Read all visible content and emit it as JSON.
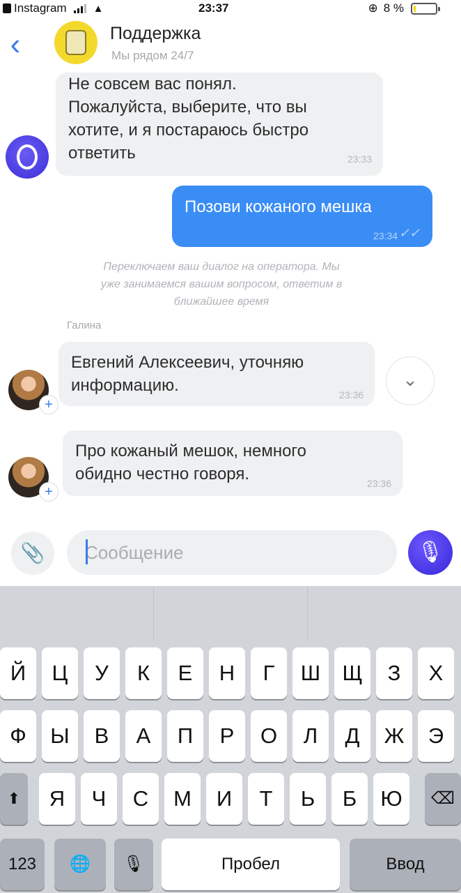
{
  "status_bar": {
    "app": "Instagram",
    "time": "23:37",
    "battery": "8 %",
    "battery_level": 0.08
  },
  "header": {
    "back_icon": "chevron-left-icon",
    "title": "Поддержка",
    "subtitle": "Мы рядом 24/7"
  },
  "messages": [
    {
      "direction": "in",
      "lines": [
        "Не совсем вас понял.",
        "Пожалуйста, выберите, что вы",
        "хотите, и я постараюсь быстро",
        "ответить"
      ],
      "time": "23:33"
    },
    {
      "direction": "out",
      "text": "Позови кожаного мешка",
      "time": "23:34",
      "status_icon": "double-check-icon"
    },
    {
      "direction": "in",
      "sender": "Галина",
      "lines": [
        "Евгений Алексеевич, уточняю",
        "информацию."
      ],
      "time": "23:36"
    },
    {
      "direction": "in",
      "lines": [
        "Про кожаный мешок, немного",
        "обидно честно говоря."
      ],
      "time": "23:36"
    }
  ],
  "system_note": {
    "lines": [
      "Переключаем ваш диалог на оператора. Мы",
      "уже занимаемся вашим вопросом, ответим в",
      "ближайшее время"
    ]
  },
  "composer": {
    "placeholder": "Сообщение",
    "value": ""
  },
  "keyboard": {
    "row1": [
      "Й",
      "Ц",
      "У",
      "К",
      "Е",
      "Н",
      "Г",
      "Ш",
      "Щ",
      "З",
      "Х"
    ],
    "row2": [
      "Ф",
      "Ы",
      "В",
      "А",
      "П",
      "Р",
      "О",
      "Л",
      "Д",
      "Ж",
      "Э"
    ],
    "row3": [
      "Я",
      "Ч",
      "С",
      "М",
      "И",
      "Т",
      "Ь",
      "Б",
      "Ю"
    ],
    "numbers_label": "123",
    "space_label": "Пробел",
    "return_label": "Ввод"
  },
  "colors": {
    "accent": "#3a8df5",
    "bubble_in": "#eef0f2",
    "mic": "#4a3af0"
  }
}
